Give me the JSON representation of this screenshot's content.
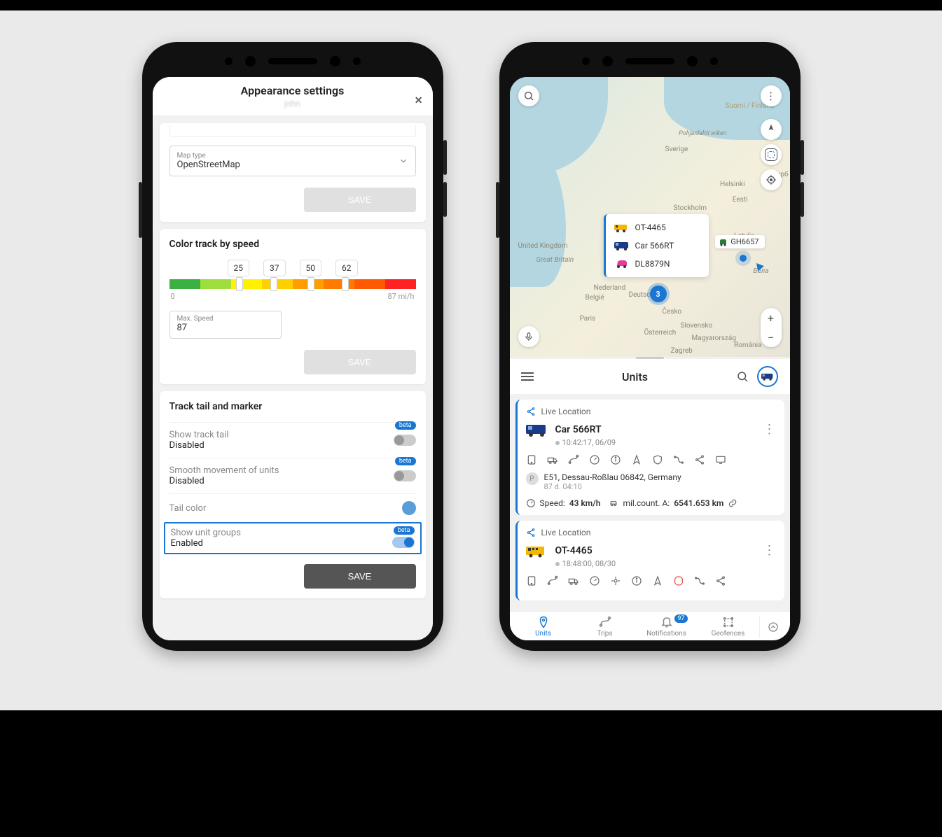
{
  "left": {
    "header": {
      "title": "Appearance settings",
      "sub": "john"
    },
    "mapType": {
      "label": "Map type",
      "value": "OpenStreetMap"
    },
    "save": "SAVE",
    "colorTrack": {
      "title": "Color track by speed",
      "stops": [
        "25",
        "37",
        "50",
        "62"
      ],
      "scaleMin": "0",
      "scaleMax": "87 mi/h",
      "maxSpeed": {
        "label": "Max. Speed",
        "value": "87"
      }
    },
    "trackTail": {
      "title": "Track tail and marker",
      "beta": "beta",
      "rows": {
        "showTail": {
          "label": "Show track tail",
          "value": "Disabled"
        },
        "smooth": {
          "label": "Smooth movement of units",
          "value": "Disabled"
        },
        "tailColor": {
          "label": "Tail color"
        },
        "showGroups": {
          "label": "Show unit groups",
          "value": "Enabled"
        }
      }
    }
  },
  "right": {
    "map": {
      "cities": {
        "uk": "United Kingdom",
        "gb": "Great Britain",
        "ned": "Nederland",
        "deu": "Deutsc",
        "bel": "Belgié",
        "paris": "Paris",
        "suomi": "Suomi / Finland",
        "sverige": "Sverige",
        "eesti": "Eesti",
        "latvija": "Latvija",
        "bela": "Бела",
        "stockholm": "Stockholm",
        "helsinki": "Helsinki",
        "cesko": "Česko",
        "slovensko": "Slovensko",
        "osterreich": "Österreich",
        "magyar": "Magyarország",
        "romania": "România",
        "zagreb": "Zagreb",
        "peter": "Петерб",
        "wiken": "Pohjanlahti wiken"
      },
      "cluster": "3",
      "units": [
        "OT-4465",
        "Car 566RT",
        "DL8879N"
      ],
      "tag": "GH6657"
    },
    "panel": {
      "title": "Units",
      "live": "Live Location",
      "card1": {
        "name": "Car 566RT",
        "time": "10:42:17, 06/09",
        "addr": "E51, Dessau-Roßlau 06842, Germany",
        "addrSub": "87 d. 04:10",
        "speedLabel": "Speed:",
        "speed": "43 km/h",
        "milLabel": "mil.count. A:",
        "mil": "6541.653 km"
      },
      "card2": {
        "name": "OT-4465",
        "time": "18:48:00, 08/30"
      }
    },
    "nav": {
      "units": "Units",
      "trips": "Trips",
      "notifications": "Notifications",
      "notifBadge": "97",
      "geofences": "Geofences"
    }
  }
}
